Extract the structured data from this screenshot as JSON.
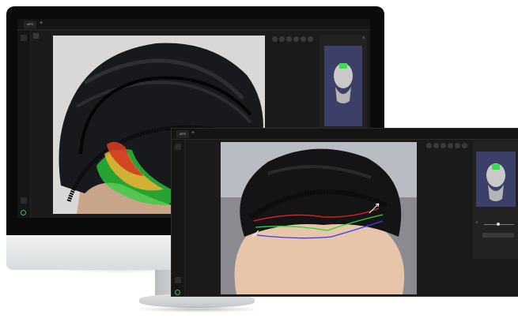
{
  "window1": {
    "tab_label": "AFS",
    "tab_add": "+",
    "sidebar_label": "",
    "panel_close": "x"
  },
  "window2": {
    "tab_label": "AFS",
    "tab_add": "+",
    "sidebar_label": "",
    "panel_close": "x",
    "slider_value": "5",
    "panel_button": ""
  },
  "toolbar_icons": [
    "zoom-out-icon",
    "zoom-in-icon",
    "brush-icon",
    "pen-icon",
    "square-icon",
    "close-icon"
  ],
  "colors": {
    "app_bg": "#1b1b1b",
    "thumbnail_bg": "#3c4068",
    "marker_green": "#35e04a",
    "line_red": "#e02020",
    "line_green": "#2ed13c",
    "line_blue": "#3a3aff",
    "power_green": "#3ec04a"
  }
}
